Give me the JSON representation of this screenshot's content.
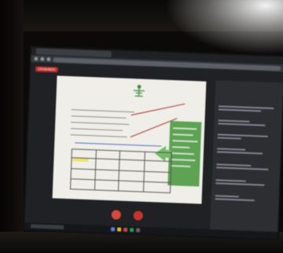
{
  "meet": {
    "recording_badge": "GRABANDO"
  },
  "colors": {
    "recording": "#c5221f",
    "end_call": "#d93025",
    "slide_green": "#56a64a"
  },
  "icons": [
    "microphone-icon",
    "end-call-icon",
    "present-icon"
  ]
}
